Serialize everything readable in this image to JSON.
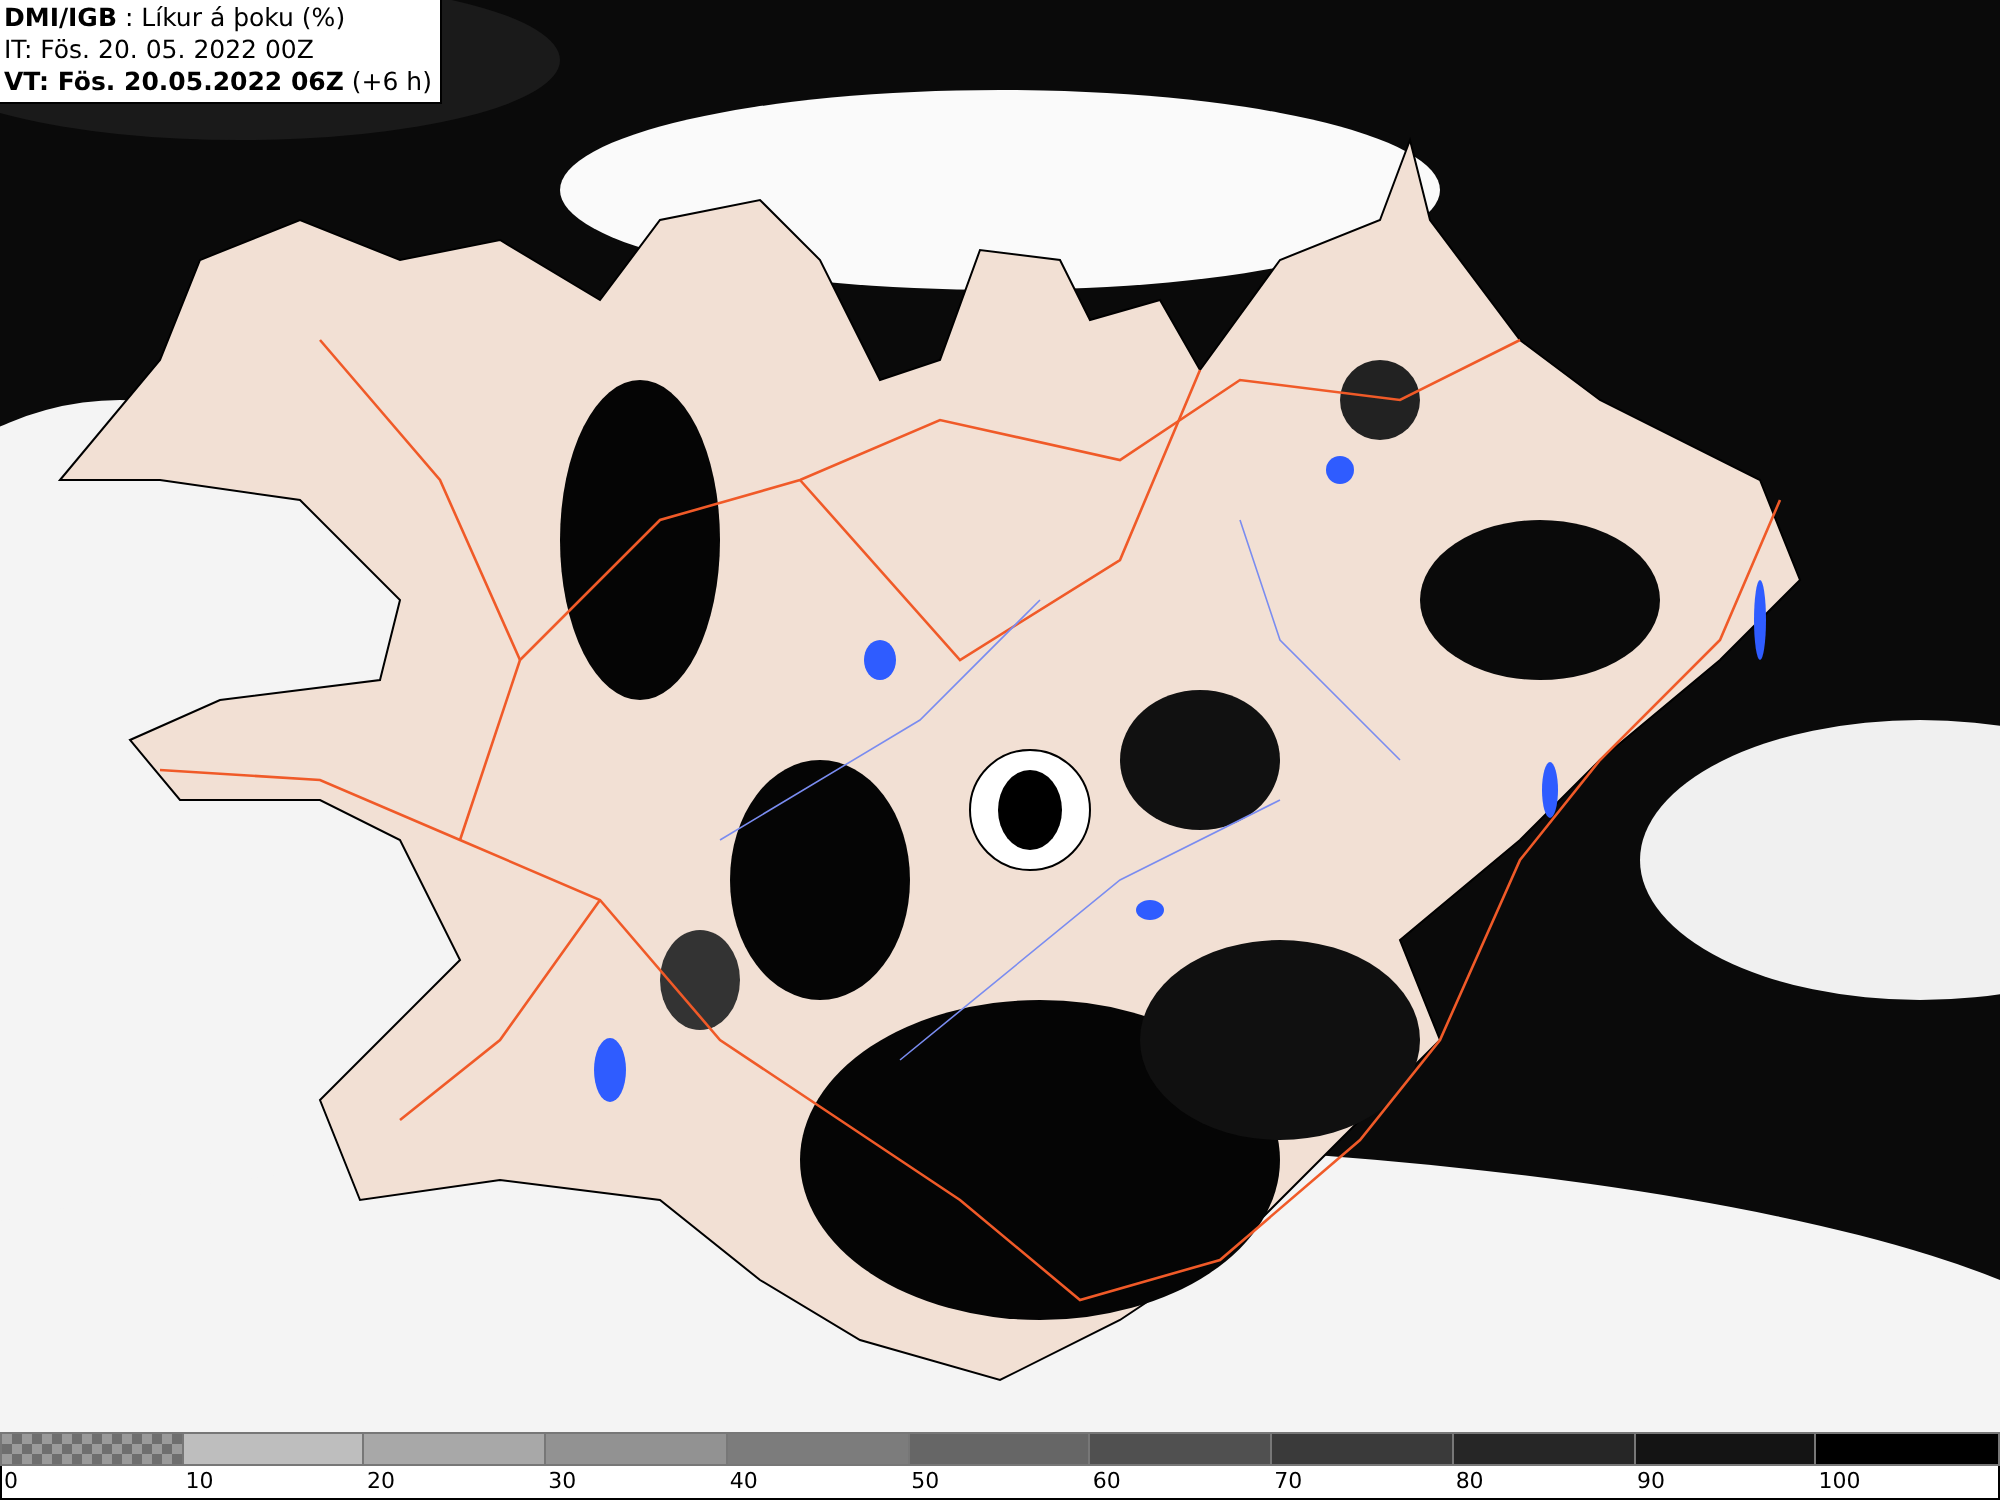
{
  "header": {
    "lines": [
      "**DMI/IGB** : Líkur á þoku (%)",
      "IT: Fös. 20. 05. 2022 00Z",
      "**VT: Fös. 20.05.2022 06Z** (+6 h)"
    ]
  },
  "legend": [
    {
      "label": "0",
      "kind": "checker",
      "color": "#6e6e6e"
    },
    {
      "label": "10",
      "kind": "solid",
      "color": "#bebebe"
    },
    {
      "label": "20",
      "kind": "solid",
      "color": "#a8a8a8"
    },
    {
      "label": "30",
      "kind": "solid",
      "color": "#929292"
    },
    {
      "label": "40",
      "kind": "solid",
      "color": "#7c7c7c"
    },
    {
      "label": "50",
      "kind": "solid",
      "color": "#666666"
    },
    {
      "label": "60",
      "kind": "solid",
      "color": "#505050"
    },
    {
      "label": "70",
      "kind": "solid",
      "color": "#3a3a3a"
    },
    {
      "label": "80",
      "kind": "solid",
      "color": "#262626"
    },
    {
      "label": "90",
      "kind": "solid",
      "color": "#141414"
    },
    {
      "label": "100",
      "kind": "solid",
      "color": "#000000"
    }
  ]
}
